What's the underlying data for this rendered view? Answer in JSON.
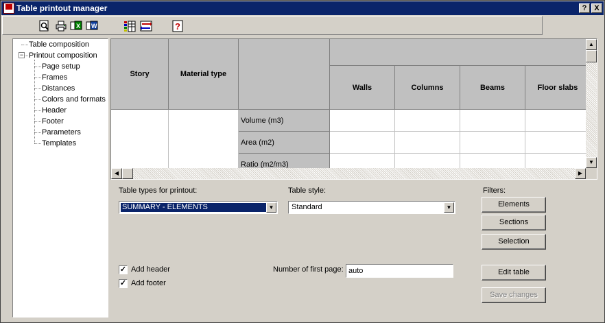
{
  "window": {
    "title": "Table printout manager",
    "help_button": "?",
    "close_button": "X"
  },
  "toolbar": {
    "icons": [
      "preview-icon",
      "print-icon",
      "excel-export-icon",
      "word-export-icon",
      "table-config-icon",
      "swap-icon",
      "help-icon"
    ]
  },
  "tree": {
    "root_items": [
      {
        "label": "Table composition"
      },
      {
        "label": "Printout composition",
        "expanded": true,
        "children": [
          "Page setup",
          "Frames",
          "Distances",
          "Colors and formats",
          "Header",
          "Footer",
          "Parameters",
          "Templates"
        ]
      }
    ]
  },
  "table": {
    "headers": {
      "story": "Story",
      "material": "Material type",
      "columns": [
        "Walls",
        "Columns",
        "Beams",
        "Floor slabs"
      ]
    },
    "row_labels": [
      "Volume (m3)",
      "Area (m2)",
      "Ratio (m2/m3)"
    ]
  },
  "controls": {
    "table_types_label": "Table types for printout:",
    "table_types_value": "SUMMARY - ELEMENTS",
    "table_style_label": "Table style:",
    "table_style_value": "Standard",
    "filters_label": "Filters:",
    "filter_buttons": [
      "Elements",
      "Sections",
      "Selection"
    ],
    "add_header_label": "Add header",
    "add_header_checked": true,
    "add_footer_label": "Add footer",
    "add_footer_checked": true,
    "first_page_label": "Number of first page:",
    "first_page_value": "auto",
    "edit_table": "Edit table",
    "save_changes": "Save changes"
  },
  "colors": {
    "titlebar": "#0a246a",
    "face": "#d4d0c8",
    "header_cell": "#c0c0c0"
  }
}
